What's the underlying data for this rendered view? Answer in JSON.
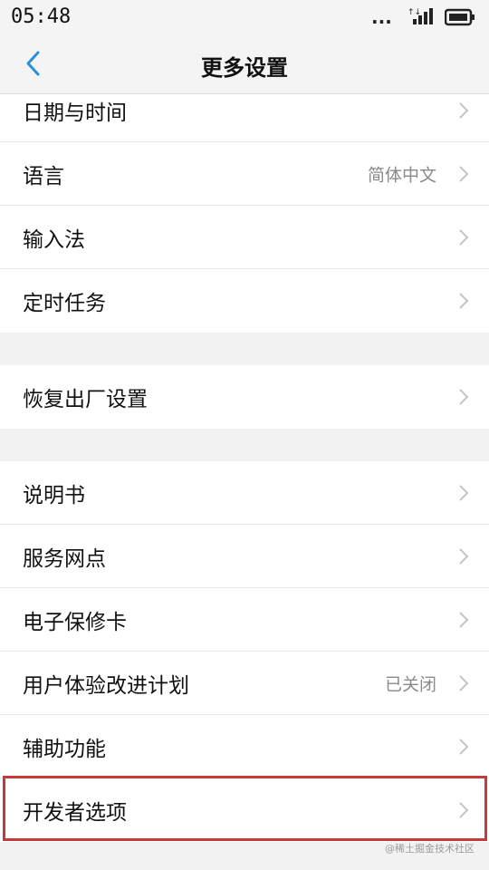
{
  "status": {
    "time": "05:48",
    "dots": "...",
    "icons": [
      "more-dots-icon",
      "signal-icon",
      "battery-icon"
    ]
  },
  "header": {
    "title": "更多设置",
    "back_icon": "chevron-left-icon"
  },
  "groups": [
    {
      "rows": [
        {
          "label": "日期与时间",
          "value": ""
        },
        {
          "label": "语言",
          "value": "简体中文"
        },
        {
          "label": "输入法",
          "value": ""
        },
        {
          "label": "定时任务",
          "value": ""
        }
      ]
    },
    {
      "rows": [
        {
          "label": "恢复出厂设置",
          "value": ""
        }
      ]
    },
    {
      "rows": [
        {
          "label": "说明书",
          "value": ""
        },
        {
          "label": "服务网点",
          "value": ""
        },
        {
          "label": "电子保修卡",
          "value": ""
        },
        {
          "label": "用户体验改进计划",
          "value": "已关闭"
        },
        {
          "label": "辅助功能",
          "value": ""
        },
        {
          "label": "开发者选项",
          "value": ""
        }
      ]
    }
  ],
  "highlight": {
    "color": "#c73a3a",
    "target": "开发者选项"
  },
  "watermark": "@稀土掘金技术社区",
  "colors": {
    "accent": "#2a8fd6",
    "chevron": "#c4c4c4"
  }
}
